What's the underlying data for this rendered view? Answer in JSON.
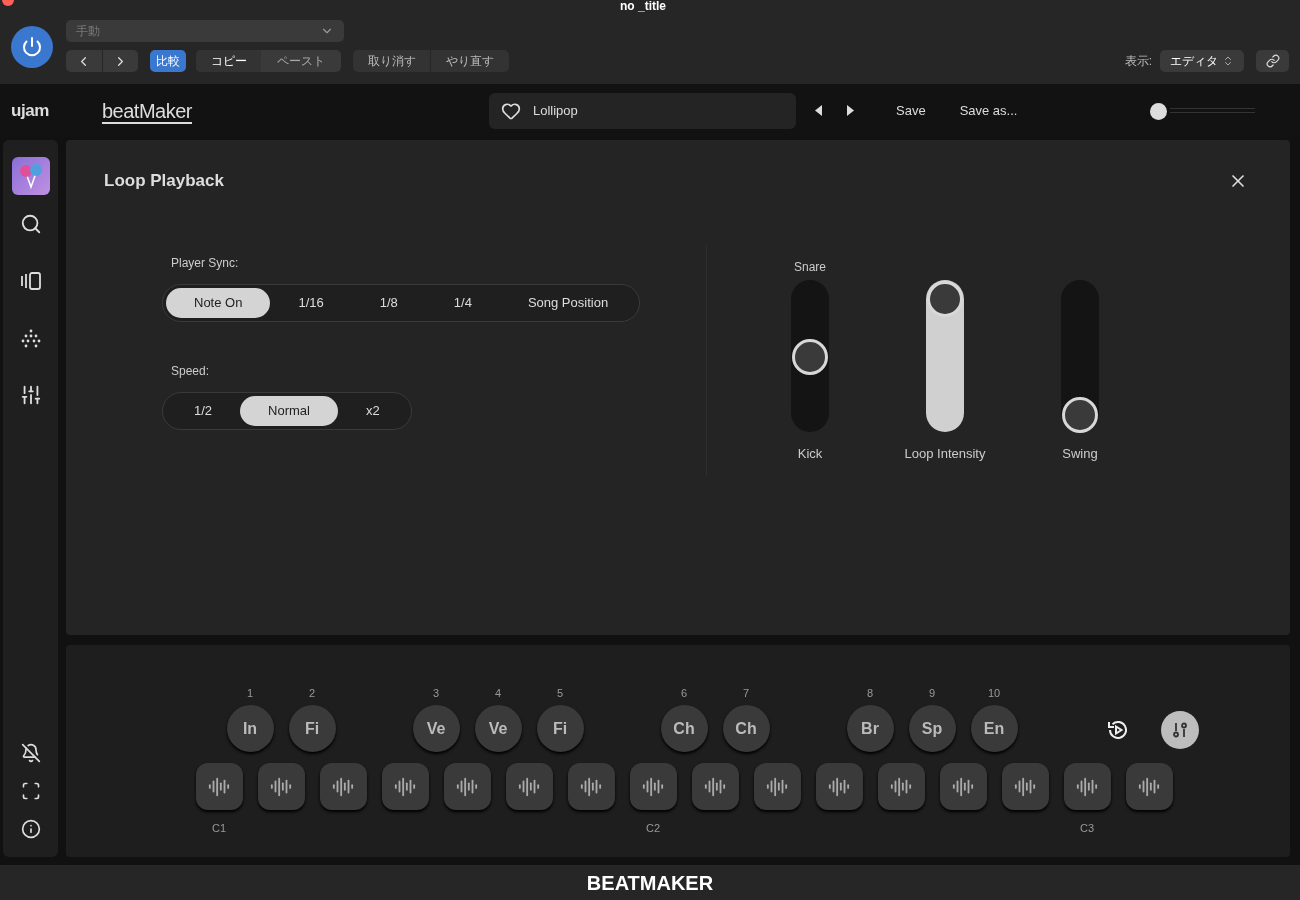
{
  "window": {
    "title": "no _title"
  },
  "host": {
    "preset": {
      "value": "手動"
    },
    "compare": {
      "label": "比較",
      "on": true
    },
    "copy": "コピー",
    "paste": "ペースト",
    "undo": "取り消す",
    "redo": "やり直す",
    "view_label": "表示:",
    "view_select": "エディタ"
  },
  "header": {
    "brand": "ujam",
    "logo": "beatMaker",
    "preset": {
      "name": "Lollipop",
      "favorite": false
    },
    "save": "Save",
    "save_as": "Save as...",
    "volume": {
      "level": 0
    }
  },
  "panel": {
    "title": "Loop Playback",
    "player_sync": {
      "label": "Player Sync:",
      "options": [
        {
          "label": "Note On",
          "selected": true
        },
        {
          "label": "1/16",
          "selected": false
        },
        {
          "label": "1/8",
          "selected": false
        },
        {
          "label": "1/4",
          "selected": false
        },
        {
          "label": "Song Position",
          "selected": false
        }
      ]
    },
    "speed": {
      "label": "Speed:",
      "options": [
        {
          "label": "1/2",
          "selected": false
        },
        {
          "label": "Normal",
          "selected": true
        },
        {
          "label": "x2",
          "selected": false
        }
      ]
    },
    "sliders": [
      {
        "kind": "crossfade",
        "top_label": "Snare",
        "label": "Kick",
        "level": 0.5
      },
      {
        "kind": "fill",
        "label": "Loop Intensity",
        "level": 1
      },
      {
        "kind": "fill",
        "label": "Swing",
        "level": 0
      }
    ]
  },
  "pads": {
    "phrases": [
      {
        "number": "1",
        "label": "In"
      },
      {
        "number": "2",
        "label": "Fi"
      },
      {
        "number": "3",
        "label": "Ve"
      },
      {
        "number": "4",
        "label": "Ve"
      },
      {
        "number": "5",
        "label": "Fi"
      },
      {
        "number": "6",
        "label": "Ch"
      },
      {
        "number": "7",
        "label": "Ch"
      },
      {
        "number": "8",
        "label": "Br"
      },
      {
        "number": "9",
        "label": "Sp"
      },
      {
        "number": "10",
        "label": "En"
      }
    ],
    "keys": [
      {
        "kind": "sample",
        "note": "C1"
      },
      {
        "kind": "sample"
      },
      {
        "kind": "sample"
      },
      {
        "kind": "sample"
      },
      {
        "kind": "sample"
      },
      {
        "kind": "sample"
      },
      {
        "kind": "sample"
      },
      {
        "kind": "sample",
        "note": "C2"
      },
      {
        "kind": "sample"
      },
      {
        "kind": "sample"
      },
      {
        "kind": "sample"
      },
      {
        "kind": "sample"
      },
      {
        "kind": "sample"
      },
      {
        "kind": "sample"
      },
      {
        "kind": "sample",
        "note": "C3"
      },
      {
        "kind": "sample"
      }
    ],
    "settings": {
      "on": true
    }
  },
  "footer": {
    "title": "BEATMAKER"
  }
}
